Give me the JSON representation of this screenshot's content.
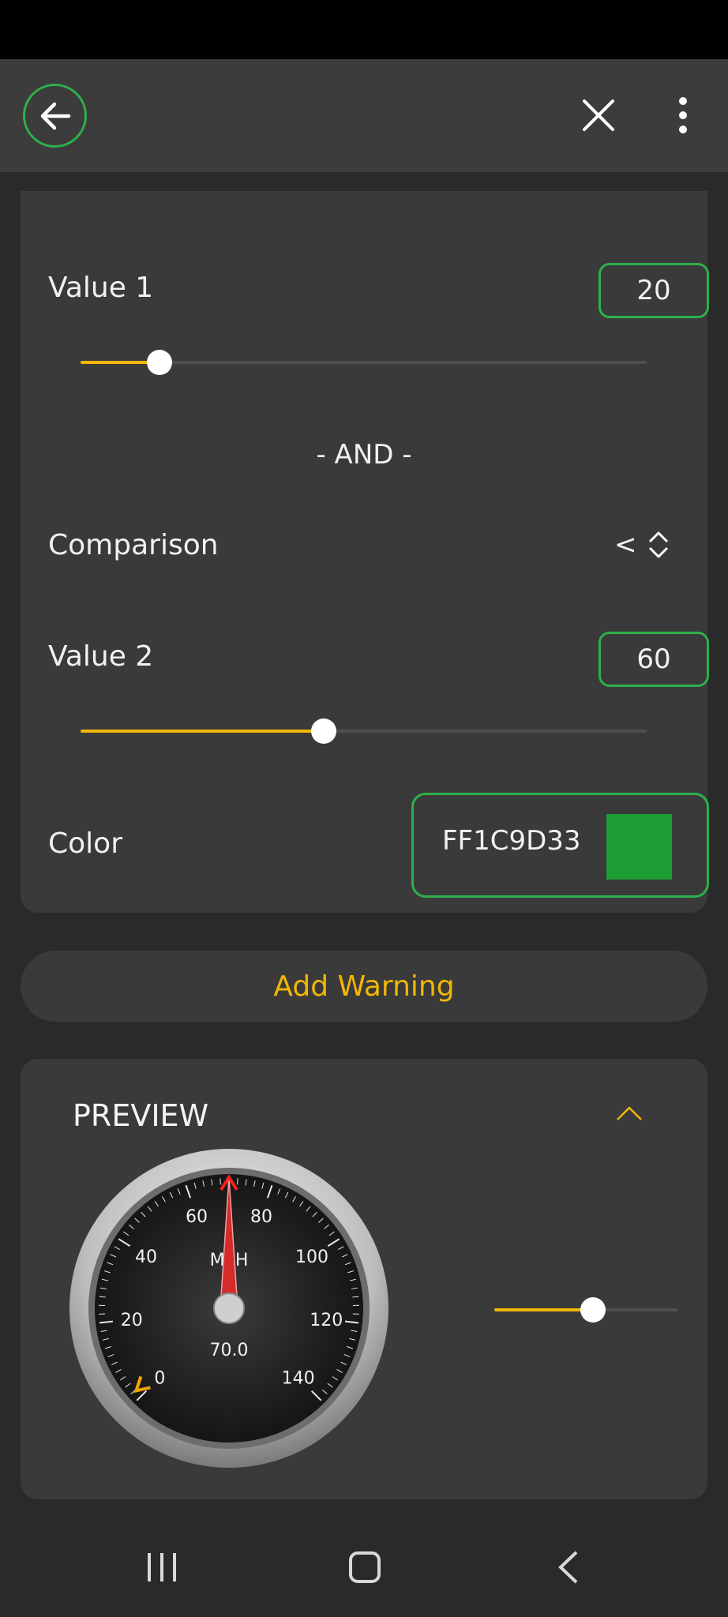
{
  "header": {
    "back_icon": "arrow-left-icon",
    "close_icon": "close-icon",
    "more_icon": "more-vertical-icon"
  },
  "warning": {
    "value1": {
      "label": "Value 1",
      "value": "20",
      "slider_fraction": 0.14
    },
    "and_label": "- AND -",
    "comparison": {
      "label": "Comparison",
      "value": "<"
    },
    "value2": {
      "label": "Value 2",
      "value": "60",
      "slider_fraction": 0.43
    },
    "color": {
      "label": "Color",
      "hex": "FF1C9D33",
      "swatch": "#1c9d33"
    }
  },
  "add_warning_label": "Add Warning",
  "preview": {
    "title": "PREVIEW",
    "gauge": {
      "unit": "MPH",
      "readout": "70.0",
      "min": 0,
      "max": 140,
      "value": 70,
      "ticks": [
        "0",
        "20",
        "40",
        "60",
        "80",
        "100",
        "120",
        "140"
      ]
    },
    "slider_fraction": 0.54
  },
  "colors": {
    "accent": "#f2b705",
    "outline_green": "#2db04b",
    "card": "#3a3a3a",
    "needle": "#d62b2b"
  }
}
